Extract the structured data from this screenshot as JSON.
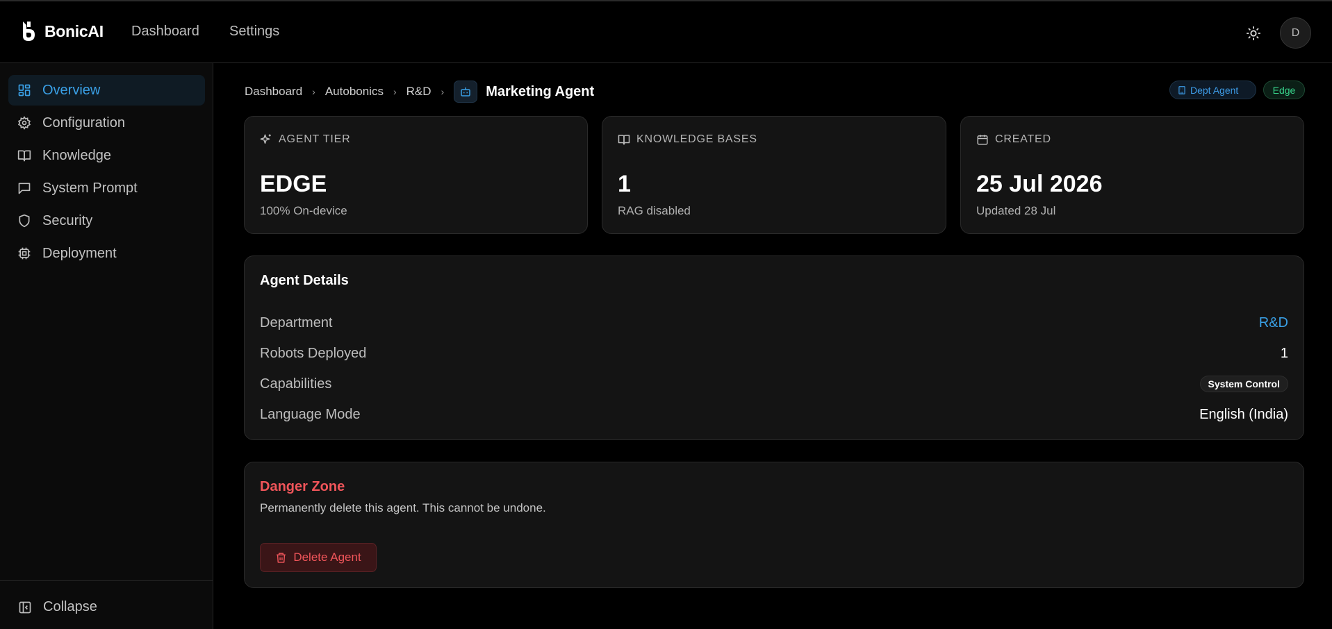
{
  "header": {
    "brand": "BonicAI",
    "nav": [
      "Dashboard",
      "Settings"
    ],
    "theme_icon": "sun-icon",
    "avatar_initial": "D"
  },
  "sidebar": {
    "items": [
      {
        "label": "Overview",
        "icon": "layout-dashboard-icon",
        "active": true
      },
      {
        "label": "Configuration",
        "icon": "gear-icon",
        "active": false
      },
      {
        "label": "Knowledge",
        "icon": "book-open-icon",
        "active": false
      },
      {
        "label": "System Prompt",
        "icon": "message-square-icon",
        "active": false
      },
      {
        "label": "Security",
        "icon": "shield-icon",
        "active": false
      },
      {
        "label": "Deployment",
        "icon": "cpu-icon",
        "active": false
      }
    ],
    "collapse_label": "Collapse"
  },
  "breadcrumb": {
    "items": [
      "Dashboard",
      "Autobonics",
      "R&D"
    ],
    "current": "Marketing Agent"
  },
  "badges": {
    "dept": "Dept Agent",
    "tier": "Edge"
  },
  "stats": [
    {
      "label": "AGENT TIER",
      "value": "EDGE",
      "sub": "100% On-device",
      "icon": "sparkles-icon"
    },
    {
      "label": "KNOWLEDGE BASES",
      "value": "1",
      "sub": "RAG disabled",
      "icon": "book-open-icon"
    },
    {
      "label": "CREATED",
      "value": "25 Jul 2026",
      "sub": "Updated 28 Jul",
      "icon": "calendar-icon"
    }
  ],
  "details": {
    "title": "Agent Details",
    "rows": [
      {
        "key": "Department",
        "value": "R&D"
      },
      {
        "key": "Robots Deployed",
        "value": "1"
      },
      {
        "key": "Capabilities",
        "value": "System Control"
      },
      {
        "key": "Language Mode",
        "value": "English (India)"
      }
    ]
  },
  "danger": {
    "title": "Danger Zone",
    "text": "Permanently delete this agent. This cannot be undone.",
    "button": "Delete Agent"
  },
  "colors": {
    "accent": "#3aa0e6",
    "danger": "#f0555a",
    "success": "#37d38a",
    "card_bg": "#141414"
  }
}
